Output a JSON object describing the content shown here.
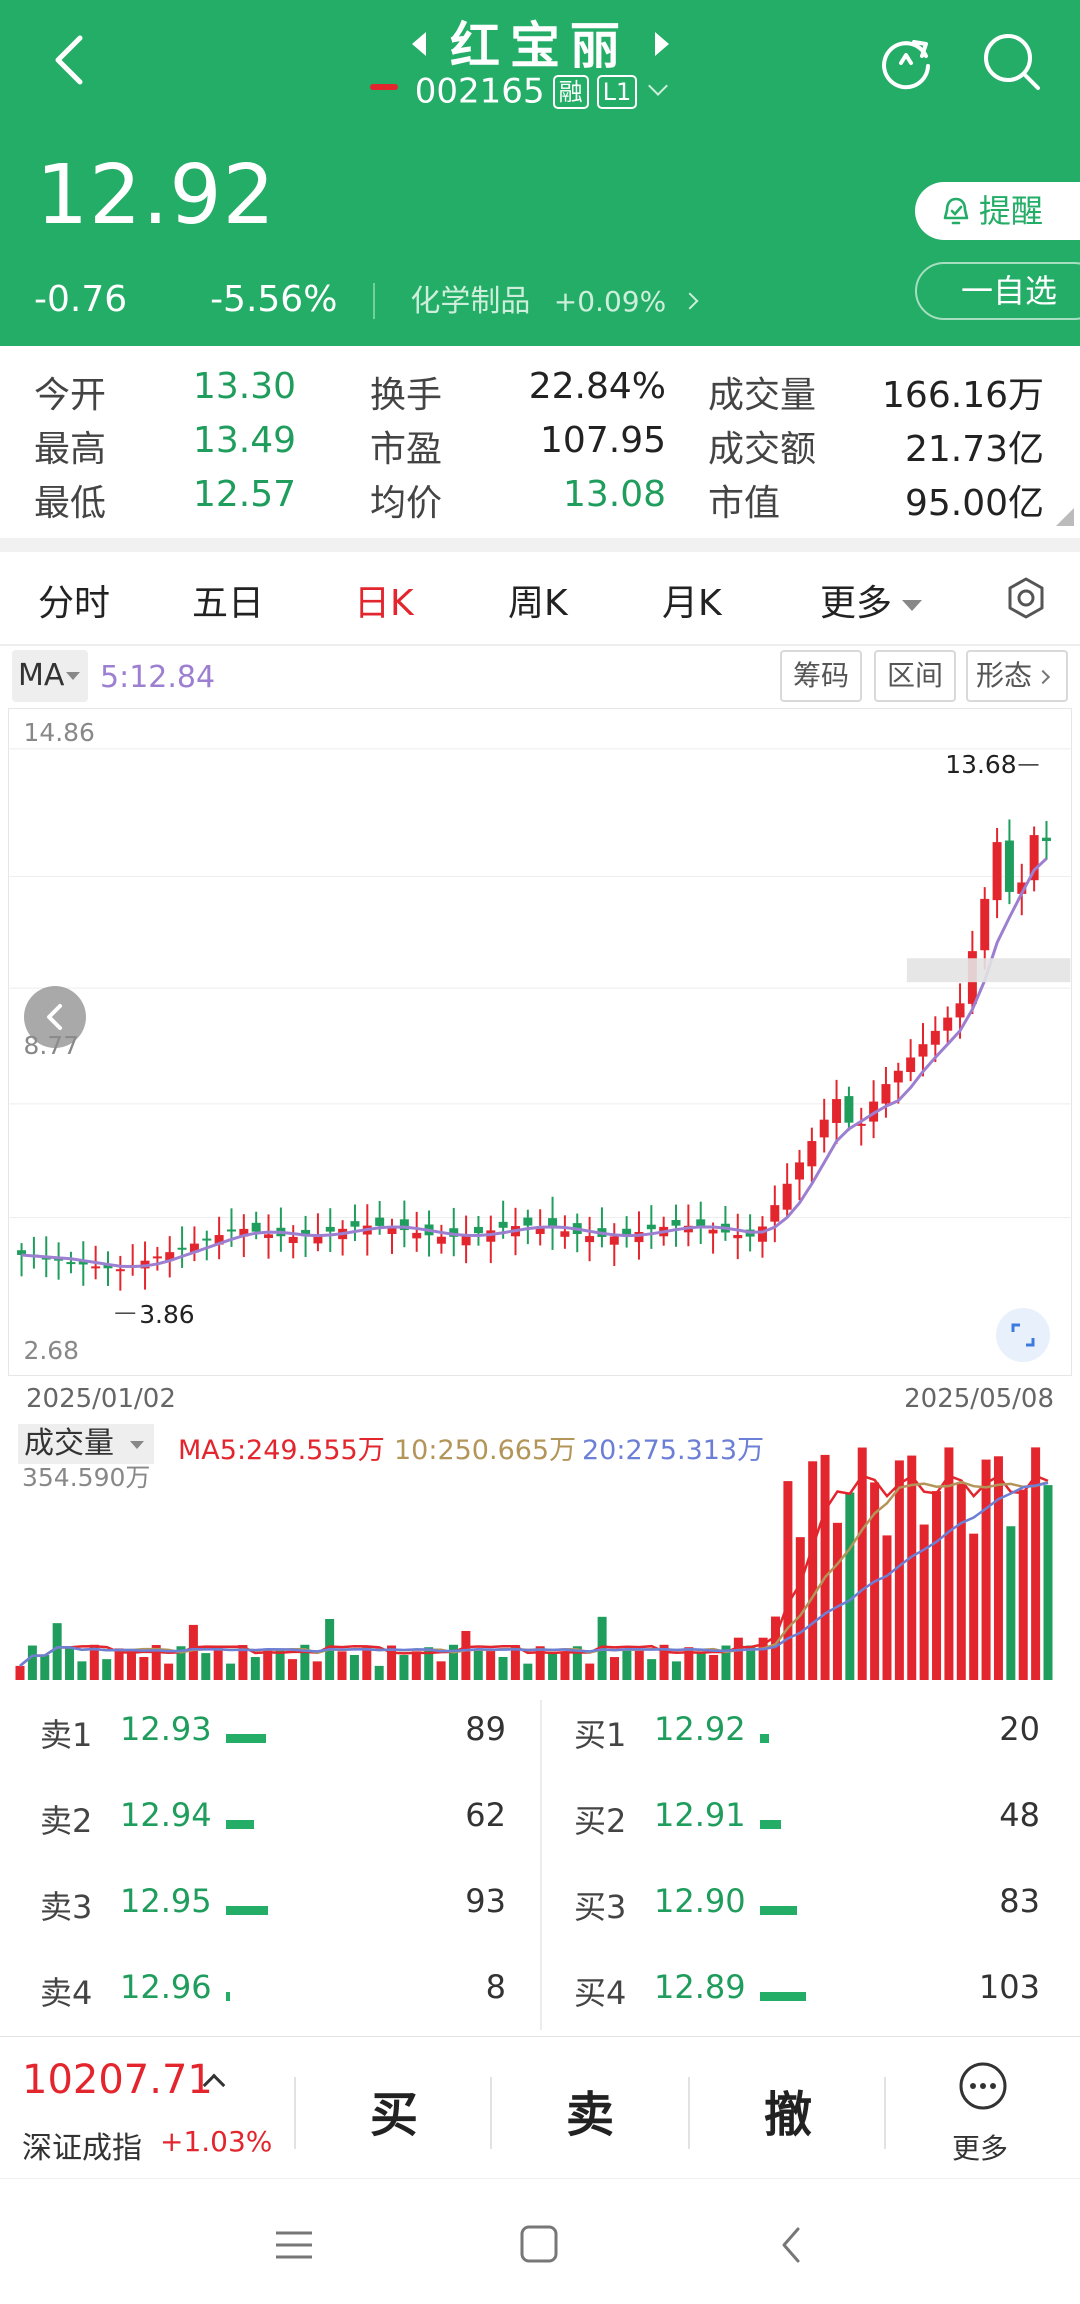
{
  "header": {
    "title": "红宝丽",
    "code": "002165",
    "tag_margin": "融",
    "tag_level": "L1",
    "price": "12.92",
    "change": "-0.76",
    "change_pct": "-5.56%",
    "industry": "化学制品",
    "industry_pct": "+0.09%",
    "remind_label": "提醒",
    "fav_label": "一自选"
  },
  "quote": [
    {
      "label": "今开",
      "value": "13.30",
      "color": "green"
    },
    {
      "label": "换手",
      "value": "22.84%",
      "color": "dark"
    },
    {
      "label": "成交量",
      "value": "166.16万",
      "color": "dark"
    },
    {
      "label": "最高",
      "value": "13.49",
      "color": "green"
    },
    {
      "label": "市盈",
      "value": "107.95",
      "color": "dark"
    },
    {
      "label": "成交额",
      "value": "21.73亿",
      "color": "dark"
    },
    {
      "label": "最低",
      "value": "12.57",
      "color": "green"
    },
    {
      "label": "均价",
      "value": "13.08",
      "color": "green"
    },
    {
      "label": "市值",
      "value": "95.00亿",
      "color": "dark"
    }
  ],
  "tabs": [
    "分时",
    "五日",
    "日K",
    "周K",
    "月K",
    "更多"
  ],
  "active_tab": "日K",
  "ma_bar": {
    "selector": "MA",
    "ma5": "5:12.84",
    "buttons": [
      "筹码",
      "区间",
      "形态"
    ]
  },
  "kchart": {
    "y_top": "14.86",
    "y_mid": "8.77",
    "y_bottom": "2.68",
    "high_label": "13.68",
    "low_label": "3.86",
    "date_start": "2025/01/02",
    "date_end": "2025/05/08"
  },
  "volume": {
    "selector": "成交量",
    "ma5": "MA5:249.555万",
    "ma10": "10:250.665万",
    "ma20": "20:275.313万",
    "y_top": "354.590万"
  },
  "chart_data": {
    "type": "candlestick",
    "ylim": [
      2.68,
      14.86
    ],
    "x": [
      "2025/01/02",
      "2025/05/08"
    ],
    "high_marker": 13.68,
    "low_marker": 3.86,
    "ma5_last": 12.84,
    "close_last": 12.92,
    "volume_ylim": [
      0,
      354.59
    ],
    "volume_unit": "万",
    "volume_ma5": 249.555,
    "volume_ma10": 250.665,
    "volume_ma20": 275.313
  },
  "orderbook": {
    "sell": [
      {
        "label": "卖1",
        "price": "12.93",
        "vol": "89"
      },
      {
        "label": "卖2",
        "price": "12.94",
        "vol": "62"
      },
      {
        "label": "卖3",
        "price": "12.95",
        "vol": "93"
      },
      {
        "label": "卖4",
        "price": "12.96",
        "vol": "8"
      }
    ],
    "buy": [
      {
        "label": "买1",
        "price": "12.92",
        "vol": "20"
      },
      {
        "label": "买2",
        "price": "12.91",
        "vol": "48"
      },
      {
        "label": "买3",
        "price": "12.90",
        "vol": "83"
      },
      {
        "label": "买4",
        "price": "12.89",
        "vol": "103"
      }
    ]
  },
  "trade": {
    "index_value": "10207.71",
    "index_name": "深证成指",
    "index_pct": "+1.03%",
    "buy": "买",
    "sell": "卖",
    "cancel": "撤",
    "more": "更多"
  },
  "colors": {
    "brand": "#23ad67",
    "up": "#e3262d",
    "down": "#1f9d5c",
    "ma5": "#9c7fd1",
    "vol_ma5": "#e3262d",
    "vol_ma10": "#b3955a",
    "vol_ma20": "#6c7fd6"
  }
}
